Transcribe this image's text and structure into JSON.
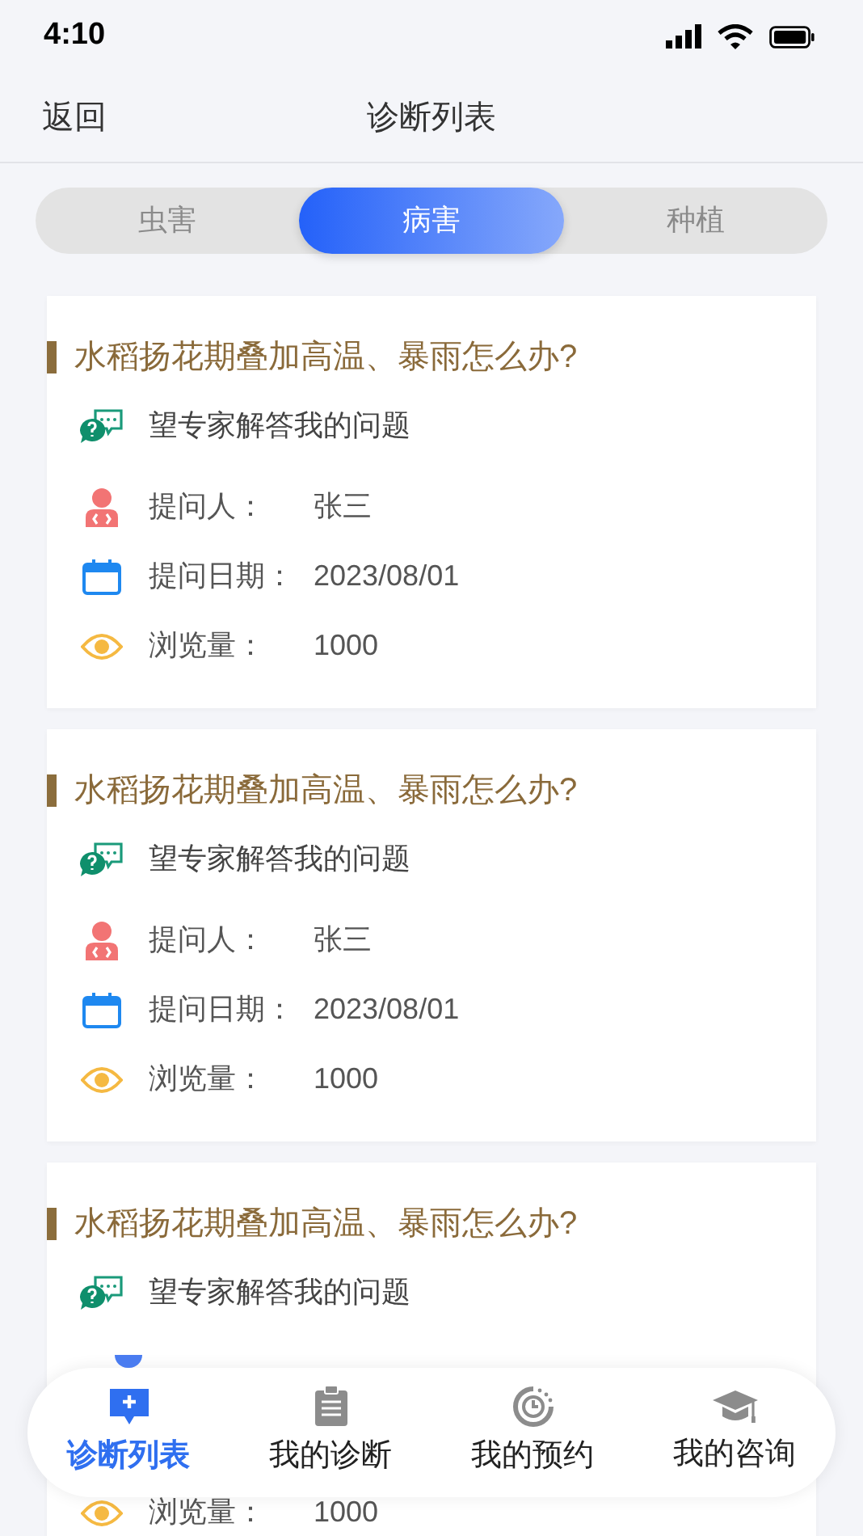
{
  "status_bar": {
    "time": "4:10"
  },
  "header": {
    "back": "返回",
    "title": "诊断列表"
  },
  "tabs": [
    {
      "label": "虫害",
      "selected": false
    },
    {
      "label": "病害",
      "selected": true
    },
    {
      "label": "种植",
      "selected": false
    }
  ],
  "cards": [
    {
      "title": "水稻扬花期叠加高温、暴雨怎么办?",
      "question": "望专家解答我的问题",
      "rows": [
        {
          "kind": "asker",
          "label": "提问人：",
          "value": "张三"
        },
        {
          "kind": "date",
          "label": "提问日期：",
          "value": "2023/08/01"
        },
        {
          "kind": "views",
          "label": "浏览量：",
          "value": "1000"
        }
      ]
    },
    {
      "title": "水稻扬花期叠加高温、暴雨怎么办?",
      "question": "望专家解答我的问题",
      "rows": [
        {
          "kind": "asker",
          "label": "提问人：",
          "value": "张三"
        },
        {
          "kind": "date",
          "label": "提问日期：",
          "value": "2023/08/01"
        },
        {
          "kind": "views",
          "label": "浏览量：",
          "value": "1000"
        }
      ]
    },
    {
      "title": "水稻扬花期叠加高温、暴雨怎么办?",
      "question": "望专家解答我的问题",
      "rows": [
        {
          "kind": "views",
          "label": "浏览量：",
          "value": "1000"
        }
      ]
    }
  ],
  "bottom_nav": [
    {
      "kind": "list",
      "label": "诊断列表",
      "selected": true
    },
    {
      "kind": "clipboard",
      "label": "我的诊断",
      "selected": false
    },
    {
      "kind": "clock",
      "label": "我的预约",
      "selected": false
    },
    {
      "kind": "cap",
      "label": "我的咨询",
      "selected": false
    }
  ]
}
